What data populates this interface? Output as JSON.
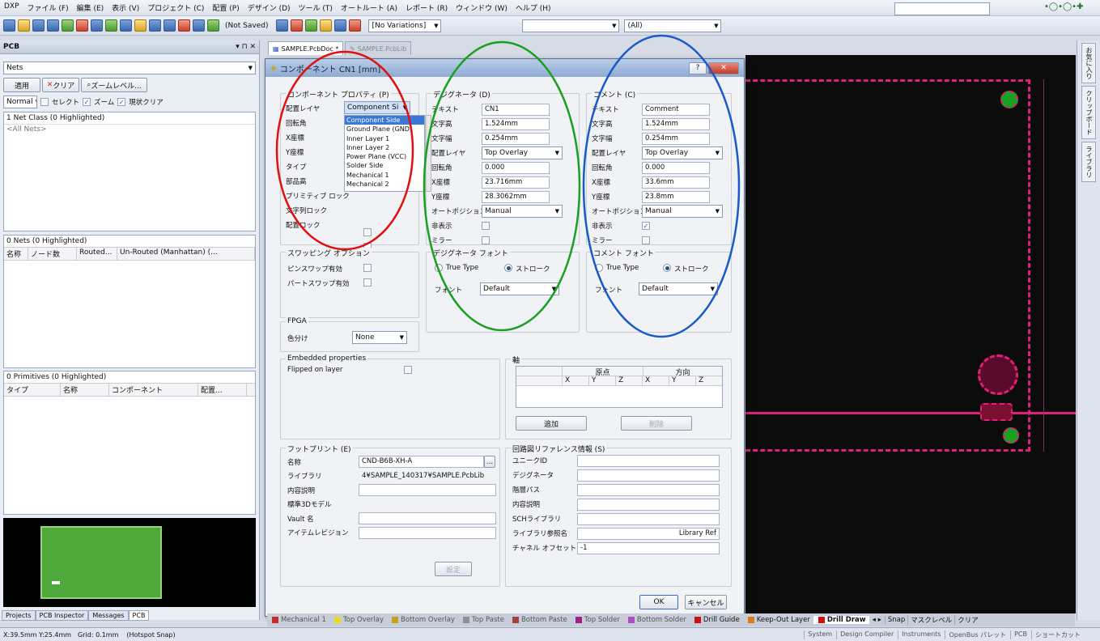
{
  "menubar": {
    "items": [
      "DXP",
      "ファイル (F)",
      "編集 (E)",
      "表示 (V)",
      "プロジェクト (C)",
      "配置 (P)",
      "デザイン (D)",
      "ツール (T)",
      "オートルート (A)",
      "レポート (R)",
      "ウィンドウ (W)",
      "ヘルプ (H)"
    ]
  },
  "toolbar": {
    "save_state": "(Not Saved)",
    "variations": "[No Variations]",
    "filter": "(All)"
  },
  "left_panel": {
    "title": "PCB",
    "mode": "Nets",
    "apply_button": "適用",
    "clear_button": "クリア",
    "zoom_level_button": "ズームレベル...",
    "normal_combo": "Normal",
    "select_label": "セレクト",
    "zoom_label": "ズーム",
    "clear_existing_label": "現状クリア",
    "netclass_header": "1 Net Class (0 Highlighted)",
    "netclass_item": "<All Nets>",
    "nets_header": "0 Nets (0 Highlighted)",
    "nets_columns": [
      "名称",
      "ノード数",
      "Routed...",
      "Un-Routed (Manhattan) (..."
    ],
    "primitives_header": "0 Primitives (0 Highlighted)",
    "primitives_columns": [
      "タイプ",
      "名称",
      "コンポーネント",
      "配置..."
    ],
    "bottom_tabs": [
      "Projects",
      "PCB Inspector",
      "Messages",
      "PCB"
    ]
  },
  "doc_tabs": [
    "SAMPLE.PcbDoc *",
    "SAMPLE.PcbLib"
  ],
  "dialog": {
    "title": "コンポーネント CN1 [mm]",
    "comp_props": {
      "title": "コンポーネント プロパティ (P)",
      "labels": [
        "配置レイヤ",
        "回転角",
        "X座標",
        "Y座標",
        "タイプ",
        "部品高",
        "プリミティブ ロック",
        "文字列ロック",
        "配置ロック"
      ],
      "layer_value": "Component Si",
      "dropdown_options": [
        "Component Side",
        "Ground Plane (GND)",
        "Inner Layer 1",
        "Inner Layer 2",
        "Power Plane (VCC)",
        "Solder Side",
        "Mechanical 1",
        "Mechanical 2"
      ]
    },
    "designator": {
      "title": "デジグネータ (D)",
      "labels": [
        "テキスト",
        "文字高",
        "文字幅",
        "配置レイヤ",
        "回転角",
        "X座標",
        "Y座標",
        "オートポジション",
        "非表示",
        "ミラー"
      ],
      "values": [
        "CN1",
        "1.524mm",
        "0.254mm",
        "Top Overlay",
        "0.000",
        "23.716mm",
        "28.3062mm",
        "Manual"
      ]
    },
    "comment": {
      "title": "コメント (C)",
      "labels": [
        "テキスト",
        "文字高",
        "文字幅",
        "配置レイヤ",
        "回転角",
        "X座標",
        "Y座標",
        "オートポジション",
        "非表示",
        "ミラー"
      ],
      "values": [
        "Comment",
        "1.524mm",
        "0.254mm",
        "Top Overlay",
        "0.000",
        "33.6mm",
        "23.8mm",
        "Manual"
      ]
    },
    "swap": {
      "title": "スワッピング オプション",
      "pin_swap": "ピンスワップ有効",
      "part_swap": "パートスワップ有効"
    },
    "des_font": {
      "title": "デジグネータ フォント",
      "truetype": "True Type",
      "stroke": "ストローク",
      "font_label": "フォント",
      "font_value": "Default"
    },
    "com_font": {
      "title": "コメント フォント",
      "truetype": "True Type",
      "stroke": "ストローク",
      "font_label": "フォント",
      "font_value": "Default"
    },
    "fpga": {
      "title": "FPGA",
      "color_label": "色分け",
      "color_value": "None"
    },
    "embedded": {
      "title": "Embedded properties",
      "flipped": "Flipped on layer"
    },
    "axis": {
      "title": "軸",
      "origin": "原点",
      "direction": "方向",
      "cols": [
        "X",
        "Y",
        "Z",
        "X",
        "Y",
        "Z"
      ],
      "add_button": "追加",
      "delete_button": "削除"
    },
    "footprint": {
      "title": "フットプリント (E)",
      "labels": [
        "名称",
        "ライブラリ",
        "内容説明",
        "標準3Dモデル",
        "Vault 名",
        "アイテムレビジョン"
      ],
      "name": "CND-B6B-XH-A",
      "library": "4¥SAMPLE_140317¥SAMPLE.PcbLib",
      "set_button": "設定"
    },
    "schematic": {
      "title": "回路図リファレンス情報 (S)",
      "labels": [
        "ユニークID",
        "デジグネータ",
        "階層パス",
        "内容説明",
        "SCHライブラリ",
        "ライブラリ参照名",
        "チャネル オフセット"
      ],
      "lib_ref": "Library Ref",
      "channel_offset": "-1"
    },
    "ok": "OK",
    "cancel": "キャンセル"
  },
  "layers": [
    "Mechanical 1",
    "Top Overlay",
    "Bottom Overlay",
    "Top Paste",
    "Bottom Paste",
    "Top Solder",
    "Bottom Solder",
    "Drill Guide",
    "Keep-Out Layer",
    "Drill Draw"
  ],
  "layer_tail": [
    "Snap",
    "マスクレベル",
    "クリア"
  ],
  "status": {
    "coords": "X:39.5mm Y:25.4mm",
    "grid": "Grid: 0.1mm",
    "snap": "(Hotspot Snap)",
    "right": [
      "System",
      "Design Compiler",
      "Instruments",
      "OpenBus パレット",
      "PCB",
      "ショートカット"
    ]
  },
  "right_tabs": [
    "お気に入り",
    "クリップボード",
    "ライブラリ"
  ],
  "colors": {
    "red": "#e01010",
    "green": "#18a020",
    "blue": "#1a5ac8",
    "magenta": "#e0207a",
    "board_green": "#4fa83a"
  }
}
